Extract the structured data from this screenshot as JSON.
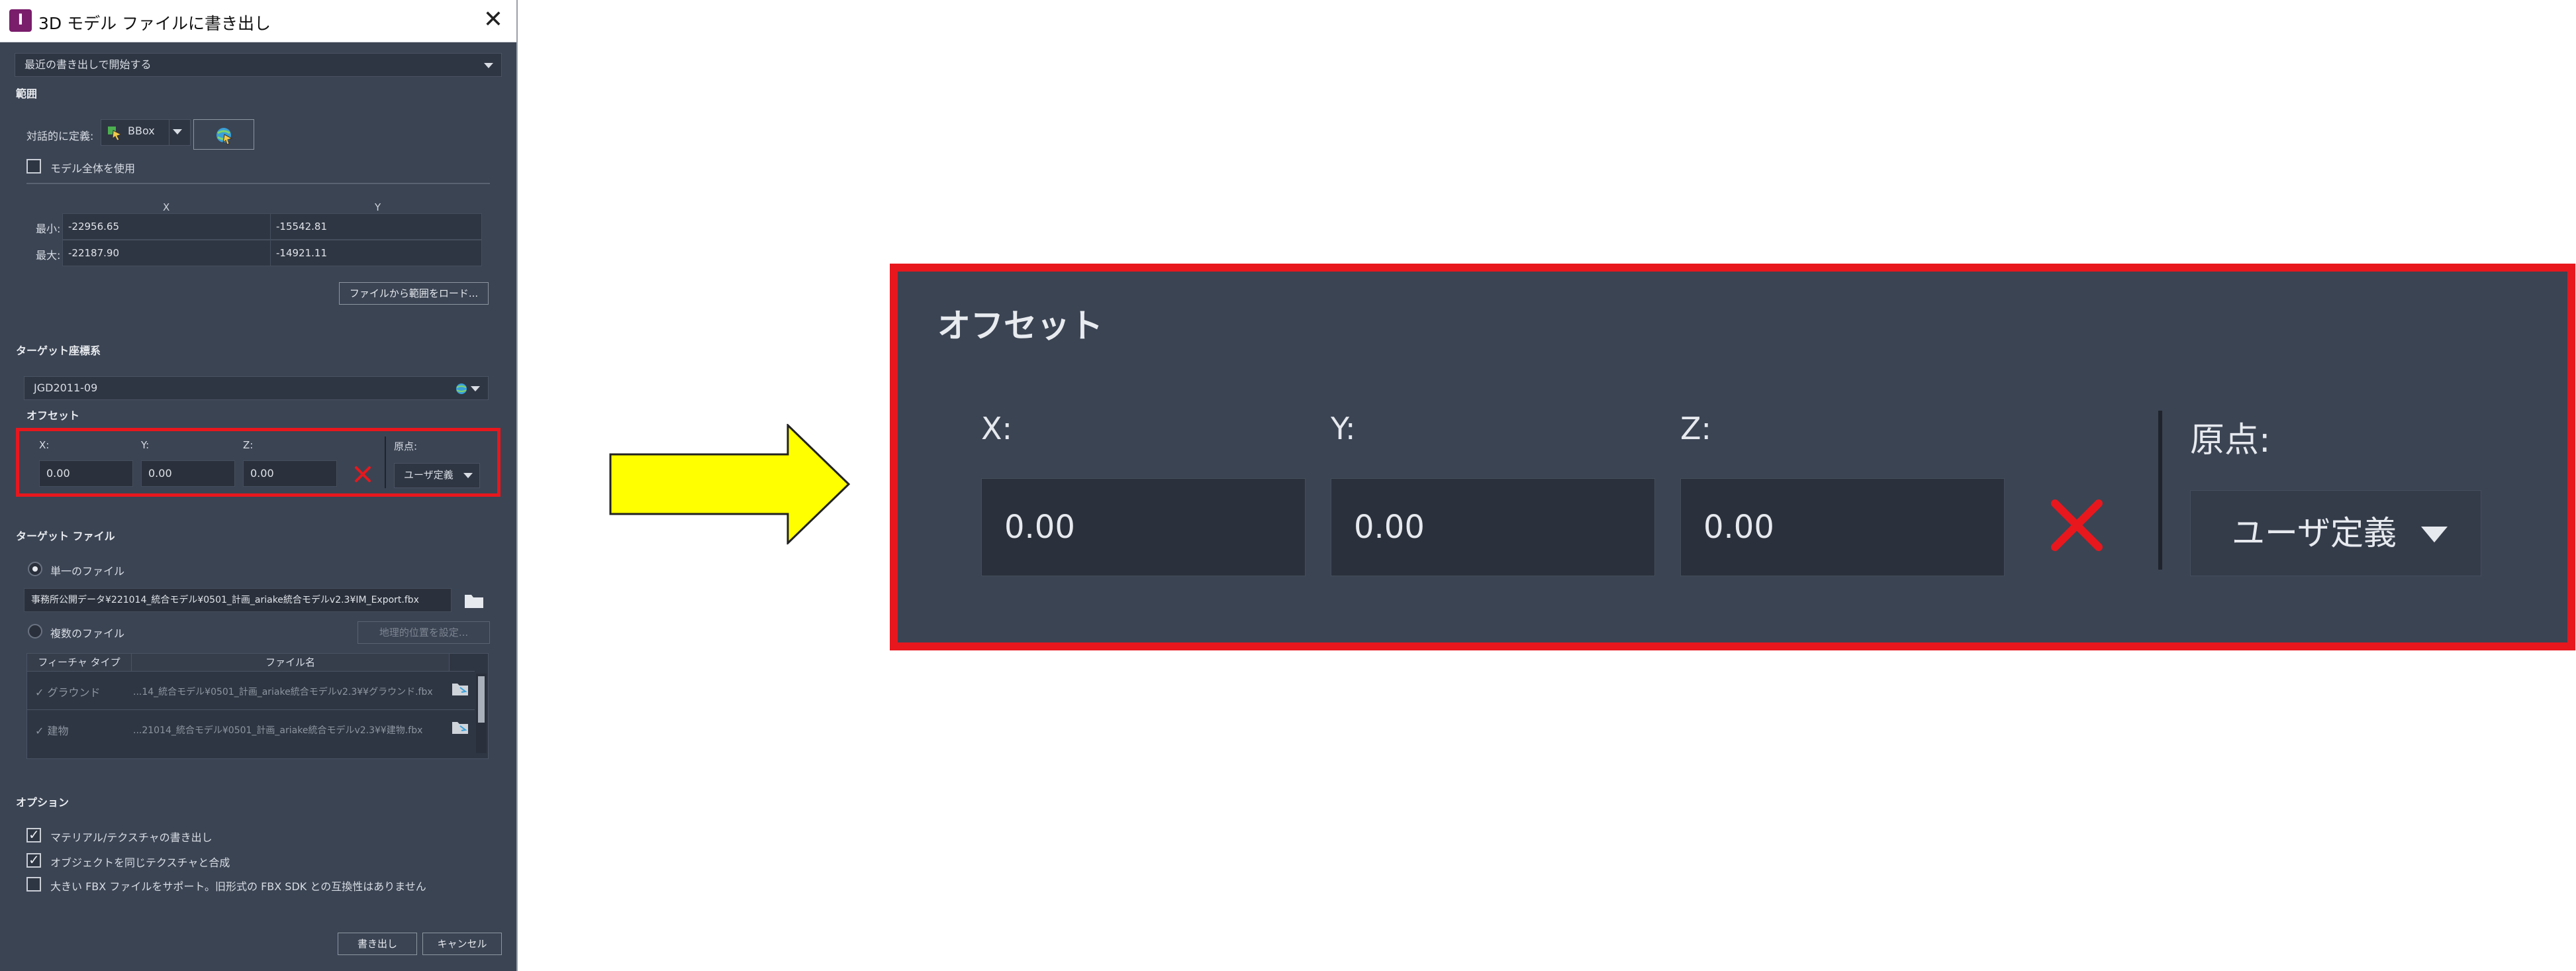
{
  "dialog": {
    "title": "3D モデル ファイルに書き出し",
    "preset": "最近の書き出しで開始する",
    "range": {
      "section": "範囲",
      "define_label": "対話的に定義:",
      "bbox_label": "BBox",
      "use_whole_model": "モデル全体を使用",
      "col_x": "X",
      "col_y": "Y",
      "min_label": "最小:",
      "max_label": "最大:",
      "min_x": "-22956.65",
      "min_y": "-15542.81",
      "max_x": "-22187.90",
      "max_y": "-14921.11",
      "load_button": "ファイルから範囲をロード..."
    },
    "target_crs": {
      "section": "ターゲット座標系",
      "value": "JGD2011-09"
    },
    "offset": {
      "section": "オフセット",
      "x_label": "X:",
      "y_label": "Y:",
      "z_label": "Z:",
      "x": "0.00",
      "y": "0.00",
      "z": "0.00",
      "origin_label": "原点:",
      "origin_value": "ユーザ定義"
    },
    "target_file": {
      "section": "ターゲット ファイル",
      "single_file": "単一のファイル",
      "single_path": "事務所公開データ¥221014_統合モデル¥0501_計画_ariake統合モデルv2.3¥IM_Export.fbx",
      "multiple_files": "複数のファイル",
      "geo_button": "地理的位置を設定...",
      "col_feature": "フィーチャ タイプ",
      "col_filename": "ファイル名",
      "rows": [
        {
          "type": "グラウンド",
          "file": "...14_統合モデル¥0501_計画_ariake統合モデルv2.3¥¥グラウンド.fbx"
        },
        {
          "type": "建物",
          "file": "...21014_統合モデル¥0501_計画_ariake統合モデルv2.3¥¥建物.fbx"
        }
      ]
    },
    "options": {
      "section": "オプション",
      "export_materials": "マテリアル/テクスチャの書き出し",
      "merge_objects": "オブジェクトを同じテクスチャと合成",
      "large_fbx": "大きい FBX ファイルをサポート。旧形式の FBX SDK との互換性はありません"
    },
    "export_button": "書き出し",
    "cancel_button": "キャンセル"
  },
  "zoom": {
    "title": "オフセット",
    "x_label": "X:",
    "y_label": "Y:",
    "z_label": "Z:",
    "x": "0.00",
    "y": "0.00",
    "z": "0.00",
    "origin_label": "原点:",
    "origin_value": "ユーザ定義"
  },
  "colors": {
    "panel_bg": "#3b4453",
    "highlight_border": "#e8171d",
    "arrow_fill": "#ffff00",
    "clear_icon": "#e8171d"
  }
}
